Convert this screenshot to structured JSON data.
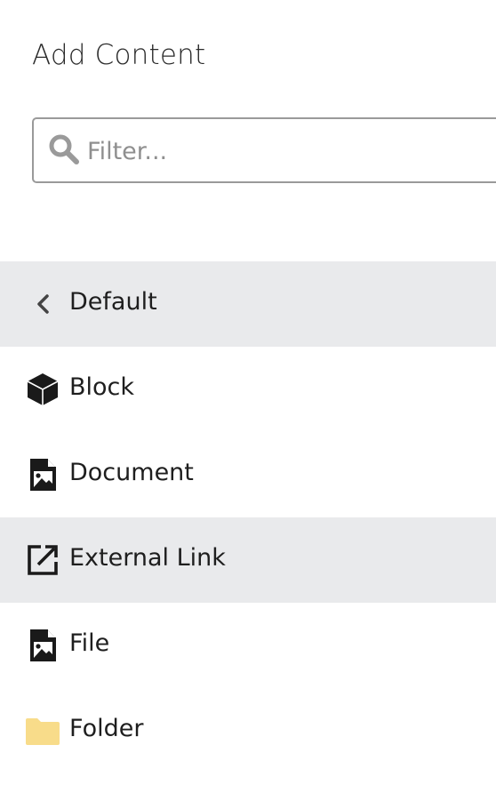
{
  "header": {
    "title": "Add Content"
  },
  "search": {
    "placeholder": "Filter...",
    "value": ""
  },
  "list": {
    "back": {
      "label": "Default",
      "icon": "chevron-left-icon"
    },
    "items": [
      {
        "label": "Block",
        "icon": "cube-icon"
      },
      {
        "label": "Document",
        "icon": "document-image-icon"
      },
      {
        "label": "External Link",
        "icon": "external-link-icon"
      },
      {
        "label": "File",
        "icon": "file-image-icon"
      },
      {
        "label": "Folder",
        "icon": "folder-icon"
      }
    ]
  },
  "colors": {
    "highlight_row": "#e9eaec",
    "folder_icon": "#f8dc8a",
    "icon_dark": "#1a1a1a",
    "search_border": "#9a9a9a"
  }
}
